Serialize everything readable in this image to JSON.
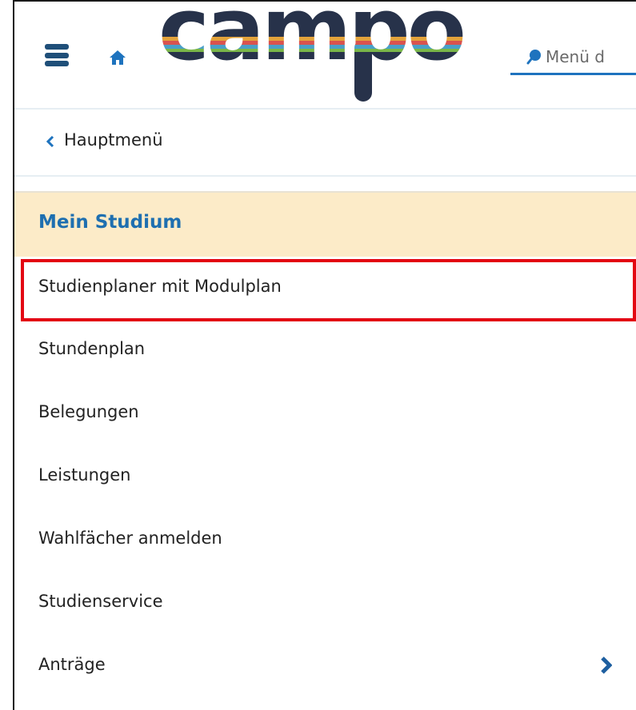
{
  "header": {
    "logo_text": "campo",
    "search_placeholder": "Menü d",
    "icons": [
      "hamburger-menu-icon",
      "home-icon",
      "search-icon"
    ],
    "accent_color": "#1e73be"
  },
  "navigation": {
    "back_label": "Hauptmenü"
  },
  "section": {
    "title": "Mein Studium",
    "background_color": "#fcebc8",
    "title_color": "#1e6fb0"
  },
  "menu": {
    "items": [
      {
        "label": "Studienplaner mit Modulplan",
        "highlighted": true
      },
      {
        "label": "Stundenplan"
      },
      {
        "label": "Belegungen"
      },
      {
        "label": "Leistungen"
      },
      {
        "label": "Wahlfächer anmelden"
      },
      {
        "label": "Studienservice"
      },
      {
        "label": "Anträge",
        "has_submenu": true
      }
    ],
    "highlight_color": "#e30613"
  }
}
